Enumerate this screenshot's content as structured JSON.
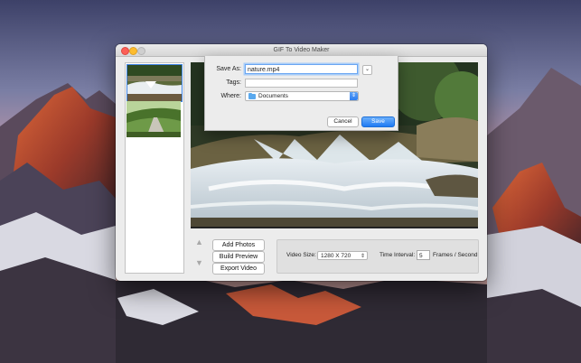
{
  "window": {
    "title": "GIF To Video Maker"
  },
  "thumbnails": [
    {
      "name": "waterfall-thumbnail"
    },
    {
      "name": "path-thumbnail"
    }
  ],
  "buttons": {
    "add_photos": "Add Photos",
    "build_preview": "Build Preview",
    "export_video": "Export Video"
  },
  "settings": {
    "video_size_label": "Video Size:",
    "video_size_value": "1280 X 720",
    "time_interval_label": "Time Interval:",
    "time_interval_value": "5",
    "time_interval_unit": "Frames / Second"
  },
  "save_dialog": {
    "save_as_label": "Save As:",
    "save_as_value": "nature.mp4",
    "tags_label": "Tags:",
    "where_label": "Where:",
    "where_value": "Documents",
    "cancel_label": "Cancel",
    "save_label": "Save"
  },
  "icons": {
    "move_up": "triangle-up-icon",
    "move_down": "triangle-down-icon",
    "folder": "folder-icon",
    "expand": "chevron-down-icon",
    "stepper": "updown-chevron-icon"
  },
  "colors": {
    "accent": "#2e7ef0",
    "close": "#fc5f57",
    "minimize": "#fdbc2e"
  }
}
